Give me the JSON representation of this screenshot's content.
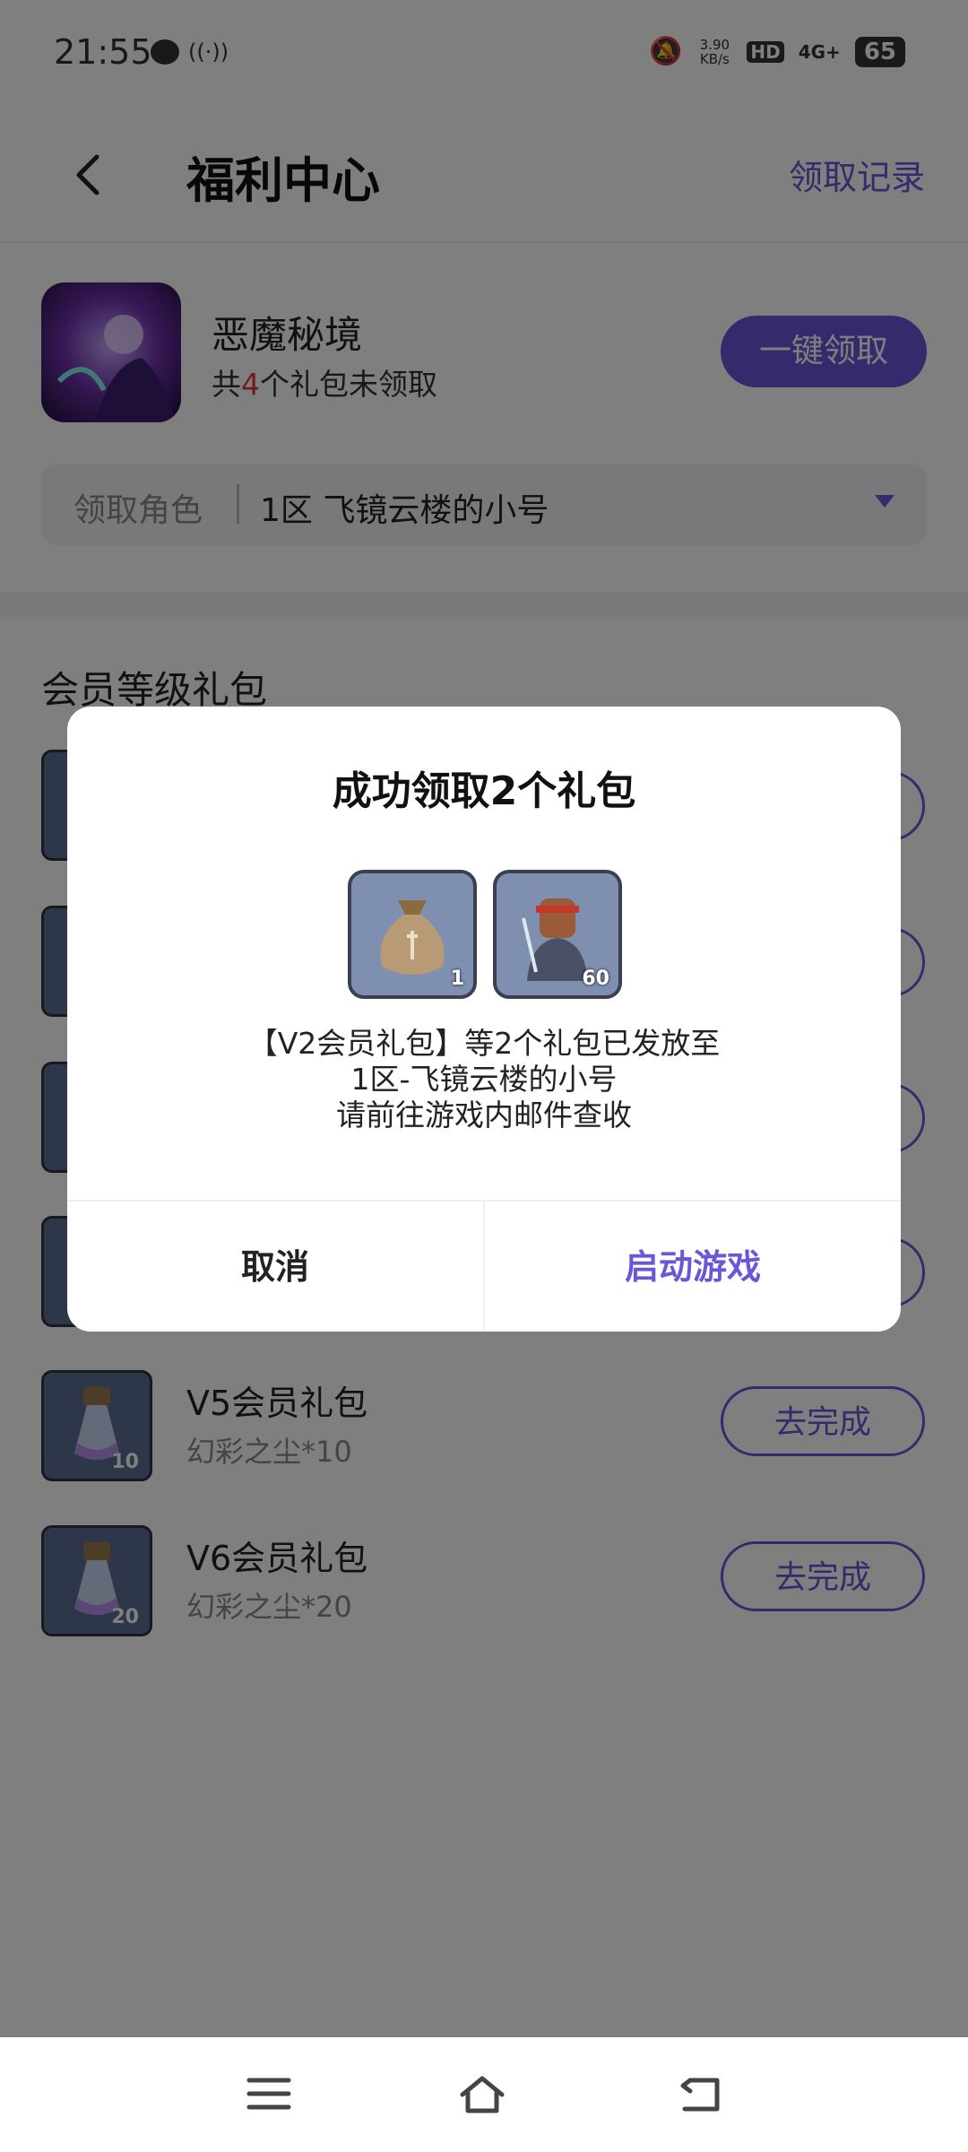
{
  "status_bar": {
    "time": "21:55",
    "net_speed": "3.90 KB/s",
    "hd": "HD",
    "signal": "4G+",
    "battery": "65"
  },
  "header": {
    "title": "福利中心",
    "records_link": "领取记录"
  },
  "game": {
    "name": "恶魔秘境",
    "gift_prefix": "共",
    "gift_count": "4",
    "gift_suffix": "个礼包未领取",
    "claim_all": "一键领取"
  },
  "role": {
    "label": "领取角色",
    "value": "1区 飞镜云楼的小号"
  },
  "section_title": "会员等级礼包",
  "list": [
    {
      "title": "V5会员礼包",
      "sub": "幻彩之尘*10",
      "qty": "10",
      "button": "去完成"
    },
    {
      "title": "V6会员礼包",
      "sub": "幻彩之尘*20",
      "qty": "20",
      "button": "去完成"
    }
  ],
  "modal": {
    "title": "成功领取2个礼包",
    "rewards": [
      {
        "qty": "1"
      },
      {
        "qty": "60"
      }
    ],
    "msg_line1": "【V2会员礼包】等2个礼包已发放至",
    "msg_line2": "1区-飞镜云楼的小号",
    "msg_line3": "请前往游戏内邮件查收",
    "cancel": "取消",
    "launch": "启动游戏"
  },
  "colors": {
    "accent": "#6b55d9",
    "highlight": "#e03b3b"
  }
}
